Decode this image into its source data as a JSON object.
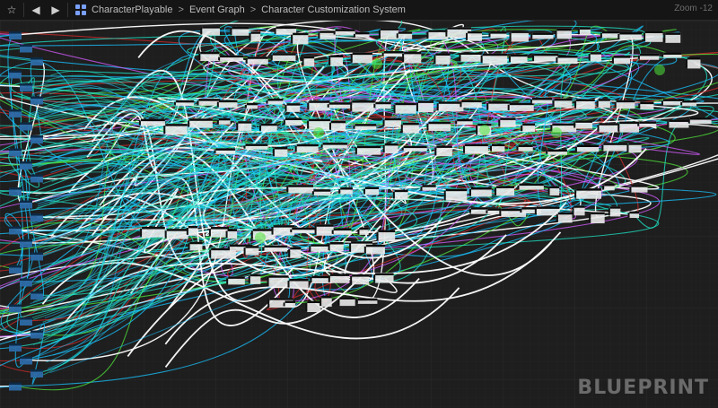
{
  "toolbar": {
    "favorite_icon": "star-icon",
    "back_icon": "arrow-left-icon",
    "forward_icon": "arrow-right-icon",
    "graph_icon": "grid-icon",
    "breadcrumbs": [
      "CharacterPlayable",
      "Event Graph",
      "Character Customization System"
    ],
    "crumb_separator": ">",
    "zoom": "Zoom -12"
  },
  "watermark": "BLUEPRINT",
  "colors": {
    "background": "#1e1e1e",
    "grid_line": "#232323",
    "node_title": "#0b0b0b",
    "node_body": "#e9e9e9",
    "wire_cyan": "#19c3ff",
    "wire_teal": "#1fe6c8",
    "wire_white": "#ffffff",
    "wire_green": "#4fe63a",
    "wire_magenta": "#d55cff",
    "wire_red": "#d12b2b"
  }
}
